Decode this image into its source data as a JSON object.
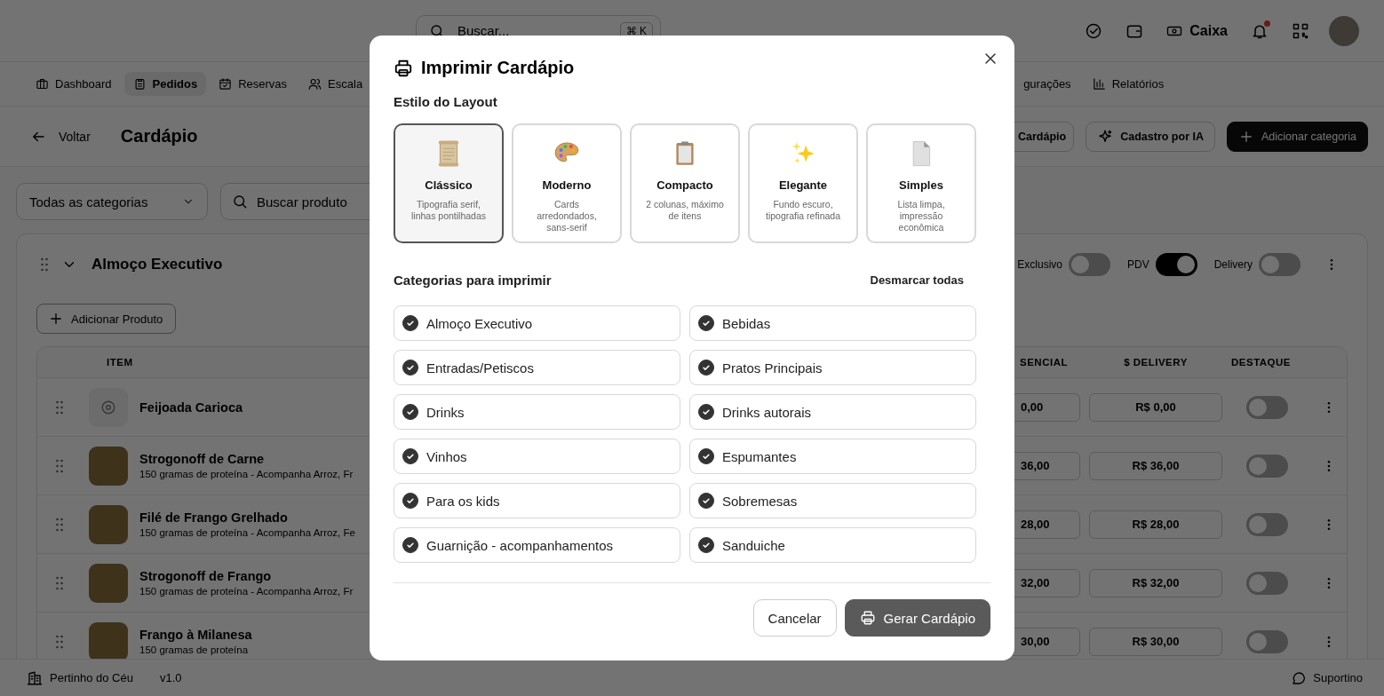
{
  "top_bar": {
    "search": {
      "placeholder": "Buscar...",
      "shortcut": "⌘ K"
    },
    "cash_label": "Caixa",
    "has_unread_notifications": true
  },
  "nav_tabs_left": [
    {
      "label": "Dashboard",
      "selected": false
    },
    {
      "label": "Pedidos",
      "selected": true
    },
    {
      "label": "Reservas",
      "selected": false
    },
    {
      "label": "Escala",
      "selected": false
    }
  ],
  "nav_tabs_right": [
    {
      "label": "gurações",
      "selected": false
    },
    {
      "label": "Relatórios",
      "selected": false
    }
  ],
  "page_header": {
    "back": "Voltar",
    "title": "Cardápio",
    "actions": [
      {
        "label": "Cardápio",
        "kind": "partial"
      },
      {
        "label": "Cadastro por IA",
        "kind": "outline"
      },
      {
        "label": "Adicionar categoria",
        "kind": "primary"
      }
    ]
  },
  "filters": {
    "category": "Todas as categorias",
    "search_placeholder": "Buscar produto"
  },
  "category": {
    "title": "Almoço Executivo",
    "expanded": true,
    "channels": [
      {
        "label": "Exclusivo",
        "on": false
      },
      {
        "label": "PDV",
        "on": true
      },
      {
        "label": "Delivery",
        "on": false
      }
    ],
    "add_button": "Adicionar Produto",
    "table": {
      "columns": [
        "ITEM",
        "SENCIAL",
        "$ DELIVERY",
        "DESTAQUE"
      ],
      "rows": [
        {
          "name": "Feijoada Carioca",
          "has_photo": false,
          "price_presencial": "0,00",
          "price_delivery": "R$ 0,00",
          "featured": false
        },
        {
          "name": "Strogonoff de Carne",
          "description": "150 gramas de proteína - Acompanha Arroz, Fr",
          "has_photo": true,
          "price_presencial": "36,00",
          "price_delivery": "R$ 36,00",
          "featured": false
        },
        {
          "name": "Filé de Frango Grelhado",
          "description": "150 gramas de proteína - Acompanha Arroz, Fe",
          "has_photo": true,
          "price_presencial": "28,00",
          "price_delivery": "R$ 28,00",
          "featured": false
        },
        {
          "name": "Strogonoff de Frango",
          "description": "150 gramas de proteína - Acompanha Arroz, Fr",
          "has_photo": true,
          "price_presencial": "32,00",
          "price_delivery": "R$ 32,00",
          "featured": false
        },
        {
          "name": "Frango à Milanesa",
          "description": "150 gramas de proteína",
          "has_photo": true,
          "price_presencial": "30,00",
          "price_delivery": "R$ 30,00",
          "featured": false
        }
      ]
    }
  },
  "footer": {
    "business": "Pertinho do Céu",
    "version": "v1.0",
    "support": "Suportino"
  },
  "dialog": {
    "title": "Imprimir Cardápio",
    "layout_label": "Estilo do Layout",
    "layouts": [
      {
        "kind": "scroll",
        "name": "Clássico",
        "description": "Tipografia serif, linhas pontilhadas",
        "selected": true
      },
      {
        "kind": "palette",
        "name": "Moderno",
        "description": "Cards arredondados, sans-serif",
        "selected": false
      },
      {
        "kind": "clipboard",
        "name": "Compacto",
        "description": "2 colunas, máximo de itens",
        "selected": false
      },
      {
        "kind": "sparkles",
        "name": "Elegante",
        "description": "Fundo escuro, tipografia refinada",
        "selected": false
      },
      {
        "kind": "page",
        "name": "Simples",
        "description": "Lista limpa, impressão econômica",
        "selected": false
      }
    ],
    "categories_label": "Categorias para imprimir",
    "toggle_all": "Desmarcar todas",
    "categories": [
      {
        "label": "Almoço Executivo",
        "checked": true
      },
      {
        "label": "Bebidas",
        "checked": true
      },
      {
        "label": "Entradas/Petiscos",
        "checked": true
      },
      {
        "label": "Pratos Principais",
        "checked": true
      },
      {
        "label": "Drinks",
        "checked": true
      },
      {
        "label": "Drinks autorais",
        "checked": true
      },
      {
        "label": "Vinhos",
        "checked": true
      },
      {
        "label": "Espumantes",
        "checked": true
      },
      {
        "label": "Para os kids",
        "checked": true
      },
      {
        "label": "Sobremesas",
        "checked": true
      },
      {
        "label": "Guarnição - acompanhamentos",
        "checked": true
      },
      {
        "label": "Sanduiche",
        "checked": true
      }
    ],
    "buttons": [
      {
        "label": "Cancelar",
        "kind": "secondary"
      },
      {
        "label": "Gerar Cardápio",
        "kind": "primary"
      }
    ]
  }
}
